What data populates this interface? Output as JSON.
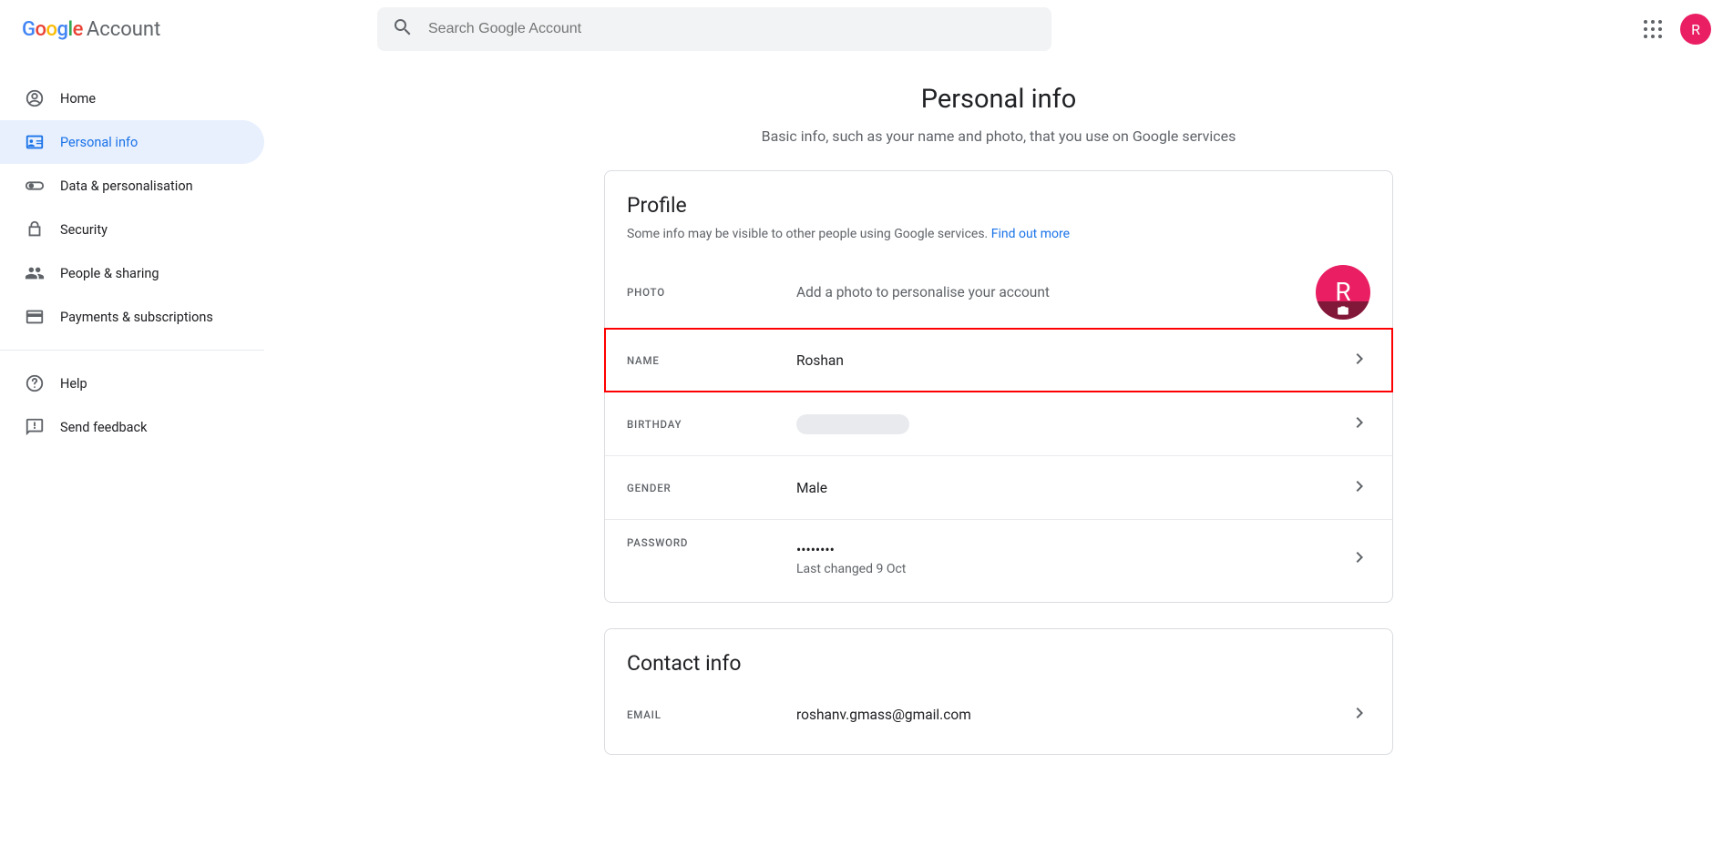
{
  "logo": {
    "account_text": "Account"
  },
  "search": {
    "placeholder": "Search Google Account"
  },
  "avatar": {
    "initial": "R"
  },
  "sidebar": {
    "items": [
      {
        "label": "Home"
      },
      {
        "label": "Personal info"
      },
      {
        "label": "Data & personalisation"
      },
      {
        "label": "Security"
      },
      {
        "label": "People & sharing"
      },
      {
        "label": "Payments & subscriptions"
      }
    ],
    "help_items": [
      {
        "label": "Help"
      },
      {
        "label": "Send feedback"
      }
    ]
  },
  "page": {
    "title": "Personal info",
    "subtitle": "Basic info, such as your name and photo, that you use on Google services"
  },
  "profile": {
    "title": "Profile",
    "desc": "Some info may be visible to other people using Google services. ",
    "link": "Find out more",
    "rows": {
      "photo": {
        "label": "PHOTO",
        "value": "Add a photo to personalise your account",
        "initial": "R"
      },
      "name": {
        "label": "NAME",
        "value": "Roshan"
      },
      "birthday": {
        "label": "BIRTHDAY"
      },
      "gender": {
        "label": "GENDER",
        "value": "Male"
      },
      "password": {
        "label": "PASSWORD",
        "value": "••••••••",
        "sub": "Last changed 9 Oct"
      }
    }
  },
  "contact": {
    "title": "Contact info",
    "rows": {
      "email": {
        "label": "EMAIL",
        "value": "roshanv.gmass@gmail.com"
      }
    }
  }
}
